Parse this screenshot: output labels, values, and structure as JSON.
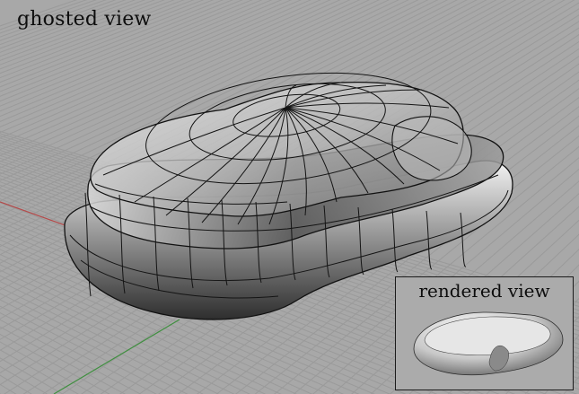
{
  "viewport": {
    "label": "ghosted view",
    "background": "#a8a8a8",
    "grid_color": "#9a9a9a",
    "x_axis_color": "#b34a4a",
    "y_axis_color": "#3f8f3f"
  },
  "inset": {
    "label": "rendered view",
    "border_color": "#1b1b1b"
  }
}
